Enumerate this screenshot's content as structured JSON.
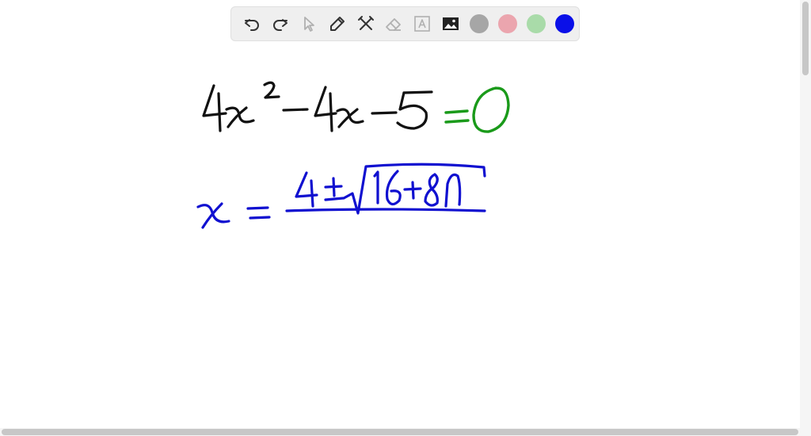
{
  "toolbar": {
    "tools": [
      "undo-icon",
      "redo-icon",
      "pointer-icon",
      "pen-icon",
      "tools-icon",
      "eraser-icon",
      "text-icon",
      "image-icon"
    ],
    "colors": [
      "#a6a6a6",
      "#eba5ae",
      "#a9dba9",
      "#0a10e8"
    ],
    "selected_color": "#0a10e8"
  },
  "ink_colors": {
    "black": "#111111",
    "green": "#1a9a1a",
    "blue": "#1010d0"
  }
}
